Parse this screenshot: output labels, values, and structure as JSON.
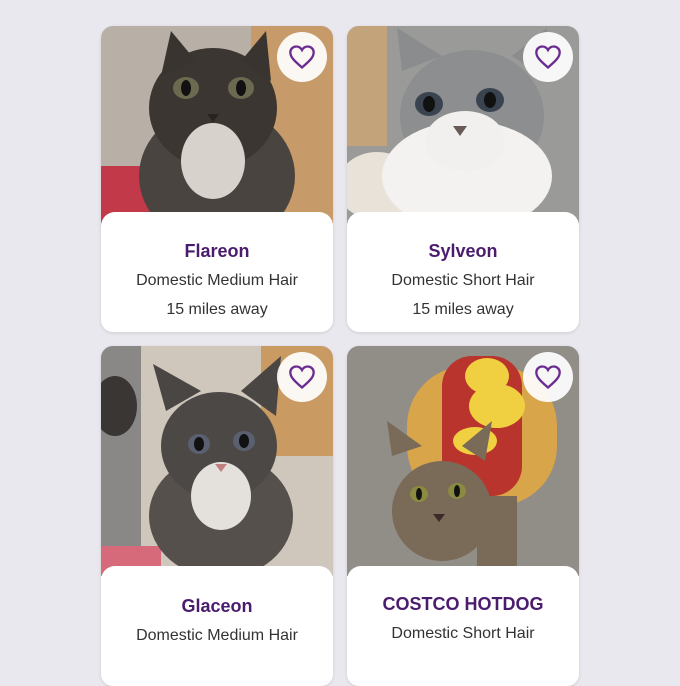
{
  "colors": {
    "background": "#e9e8ee",
    "card": "#ffffff",
    "accent": "#4a1c6e",
    "heart": "#6b2c91"
  },
  "pets": [
    {
      "name": "Flareon",
      "breed": "Domestic Medium Hair",
      "distance": "15 miles away",
      "favorite_icon": "heart-outline-icon"
    },
    {
      "name": "Sylveon",
      "breed": "Domestic Short Hair",
      "distance": "15 miles away",
      "favorite_icon": "heart-outline-icon"
    },
    {
      "name": "Glaceon",
      "breed": "Domestic Medium Hair",
      "favorite_icon": "heart-outline-icon"
    },
    {
      "name": "COSTCO HOTDOG",
      "breed": "Domestic Short Hair",
      "favorite_icon": "heart-outline-icon"
    }
  ]
}
